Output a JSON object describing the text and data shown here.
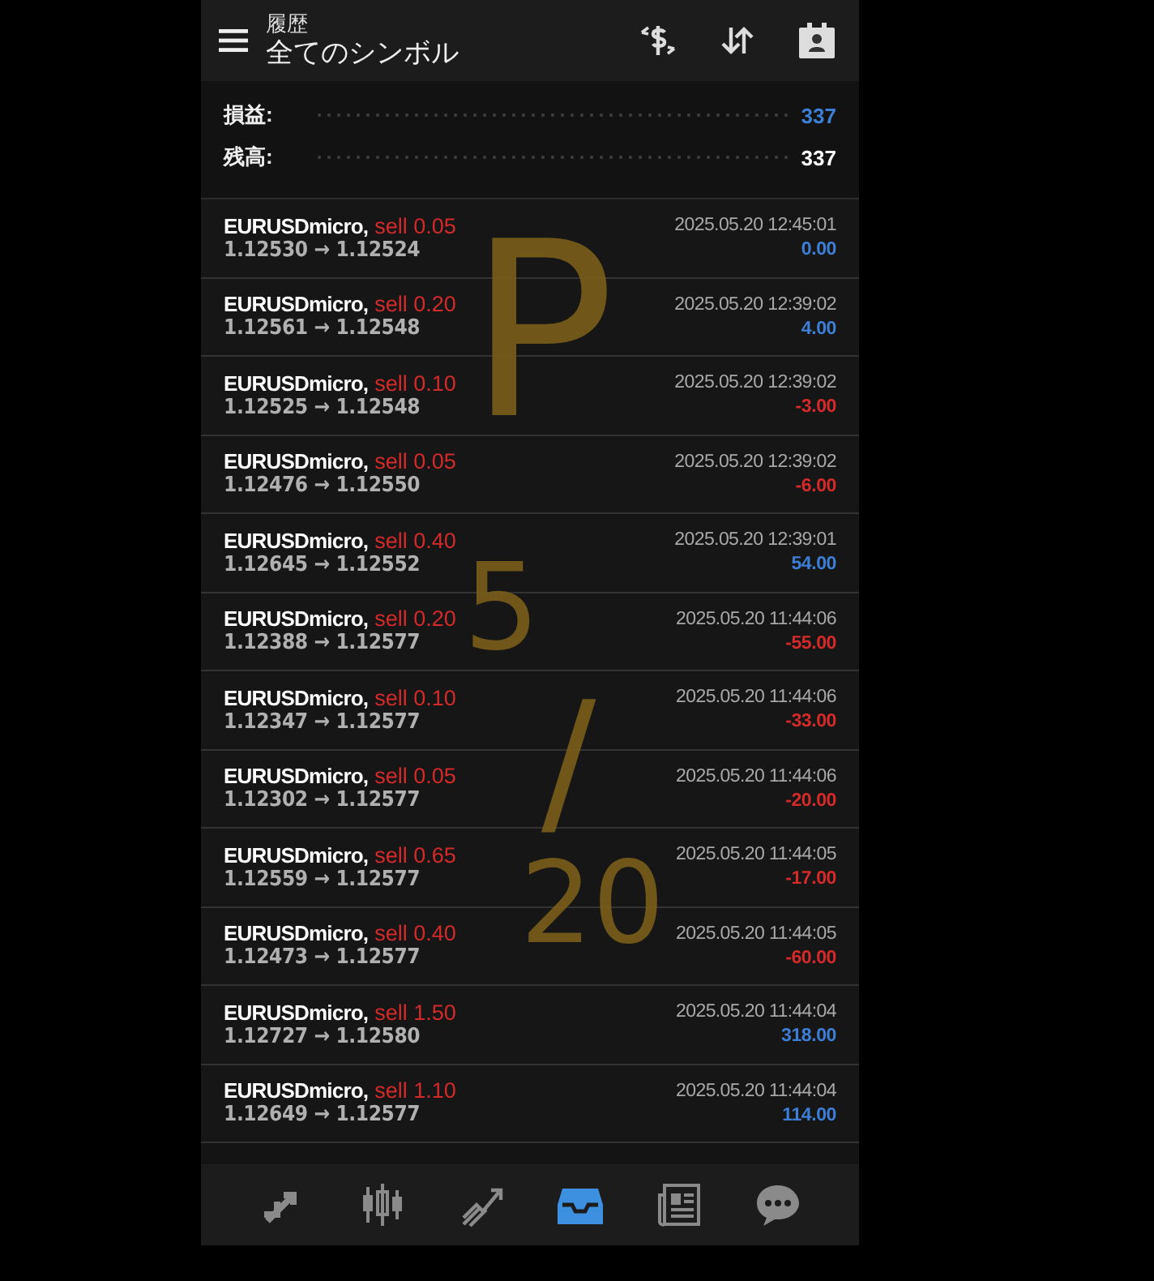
{
  "header": {
    "subtitle": "履歴",
    "title": "全てのシンボル"
  },
  "summary": [
    {
      "label": "損益:",
      "value": "337",
      "color": "#3d7fd6"
    },
    {
      "label": "残高:",
      "value": "337",
      "color": "#ffffff"
    }
  ],
  "trades": [
    {
      "symbol": "EURUSDmicro,",
      "order": "sell 0.05",
      "prices": "1.12530 → 1.12524",
      "time": "2025.05.20 12:45:01",
      "profit": "0.00",
      "color": "#3d7fd6"
    },
    {
      "symbol": "EURUSDmicro,",
      "order": "sell 0.20",
      "prices": "1.12561 → 1.12548",
      "time": "2025.05.20 12:39:02",
      "profit": "4.00",
      "color": "#3d7fd6"
    },
    {
      "symbol": "EURUSDmicro,",
      "order": "sell 0.10",
      "prices": "1.12525 → 1.12548",
      "time": "2025.05.20 12:39:02",
      "profit": "-3.00",
      "color": "#d42a2a"
    },
    {
      "symbol": "EURUSDmicro,",
      "order": "sell 0.05",
      "prices": "1.12476 → 1.12550",
      "time": "2025.05.20 12:39:02",
      "profit": "-6.00",
      "color": "#d42a2a"
    },
    {
      "symbol": "EURUSDmicro,",
      "order": "sell 0.40",
      "prices": "1.12645 → 1.12552",
      "time": "2025.05.20 12:39:01",
      "profit": "54.00",
      "color": "#3d7fd6"
    },
    {
      "symbol": "EURUSDmicro,",
      "order": "sell 0.20",
      "prices": "1.12388 → 1.12577",
      "time": "2025.05.20 11:44:06",
      "profit": "-55.00",
      "color": "#d42a2a"
    },
    {
      "symbol": "EURUSDmicro,",
      "order": "sell 0.10",
      "prices": "1.12347 → 1.12577",
      "time": "2025.05.20 11:44:06",
      "profit": "-33.00",
      "color": "#d42a2a"
    },
    {
      "symbol": "EURUSDmicro,",
      "order": "sell 0.05",
      "prices": "1.12302 → 1.12577",
      "time": "2025.05.20 11:44:06",
      "profit": "-20.00",
      "color": "#d42a2a"
    },
    {
      "symbol": "EURUSDmicro,",
      "order": "sell 0.65",
      "prices": "1.12559 → 1.12577",
      "time": "2025.05.20 11:44:05",
      "profit": "-17.00",
      "color": "#d42a2a"
    },
    {
      "symbol": "EURUSDmicro,",
      "order": "sell 0.40",
      "prices": "1.12473 → 1.12577",
      "time": "2025.05.20 11:44:05",
      "profit": "-60.00",
      "color": "#d42a2a"
    },
    {
      "symbol": "EURUSDmicro,",
      "order": "sell 1.50",
      "prices": "1.12727 → 1.12580",
      "time": "2025.05.20 11:44:04",
      "profit": "318.00",
      "color": "#3d7fd6"
    },
    {
      "symbol": "EURUSDmicro,",
      "order": "sell 1.10",
      "prices": "1.12649 → 1.12577",
      "time": "2025.05.20 11:44:04",
      "profit": "114.00",
      "color": "#3d7fd6"
    }
  ],
  "handwriting": [
    {
      "text": "P",
      "kind": "letter"
    },
    {
      "text": "5",
      "kind": "top"
    },
    {
      "text": "/",
      "kind": "slash"
    },
    {
      "text": "20",
      "kind": "bottom"
    }
  ],
  "nav": [
    {
      "kind": "quotes",
      "selected": false
    },
    {
      "kind": "chart",
      "selected": false
    },
    {
      "kind": "trade",
      "selected": false
    },
    {
      "kind": "history",
      "selected": true
    },
    {
      "kind": "news",
      "selected": false
    },
    {
      "kind": "chat",
      "selected": false
    }
  ]
}
